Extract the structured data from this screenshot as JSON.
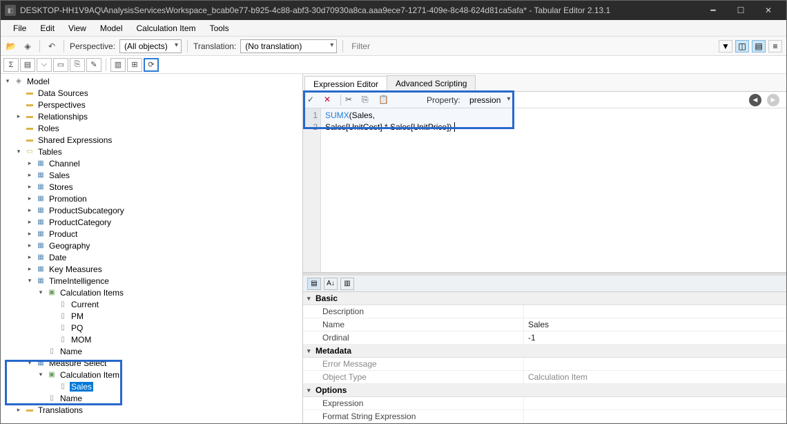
{
  "window": {
    "title": "DESKTOP-HH1V9AQ\\AnalysisServicesWorkspace_bcab0e77-b925-4c88-abf3-30d70930a8ca.aaa9ece7-1271-409e-8c48-624d81ca5afa* - Tabular Editor 2.13.1"
  },
  "menu": {
    "file": "File",
    "edit": "Edit",
    "view": "View",
    "model": "Model",
    "calcItem": "Calculation Item",
    "tools": "Tools"
  },
  "toolbar": {
    "perspective_label": "Perspective:",
    "perspective_value": "(All objects)",
    "translation_label": "Translation:",
    "translation_value": "(No translation)",
    "filter_placeholder": "Filter"
  },
  "tree": {
    "root": "Model",
    "dataSources": "Data Sources",
    "perspectives": "Perspectives",
    "relationships": "Relationships",
    "roles": "Roles",
    "sharedExpr": "Shared Expressions",
    "tables": "Tables",
    "table_items": [
      "Channel",
      "Sales",
      "Stores",
      "Promotion",
      "ProductSubcategory",
      "ProductCategory",
      "Product",
      "Geography",
      "Date",
      "Key Measures",
      "TimeIntelligence"
    ],
    "calcItemsFolder": "Calculation Items",
    "calc_items": [
      "Current",
      "PM",
      "PQ",
      "MOM"
    ],
    "nameCol": "Name",
    "measureSelect": "Measure Select",
    "calcItemFolder2": "Calculation Item",
    "selected": "Sales",
    "name2": "Name",
    "translations": "Translations"
  },
  "tabs": {
    "expr": "Expression Editor",
    "scripting": "Advanced Scripting"
  },
  "editor": {
    "property_suffix": "pression",
    "line1_fn": "SUMX",
    "line1_rest": "(Sales,",
    "line2": "Sales[UnitCost] * Sales[UnitPrice])"
  },
  "props": {
    "cat_basic": "Basic",
    "description": "Description",
    "name": "Name",
    "name_val": "Sales",
    "ordinal": "Ordinal",
    "ordinal_val": "-1",
    "cat_meta": "Metadata",
    "errorMsg": "Error Message",
    "objType": "Object Type",
    "objType_val": "Calculation Item",
    "cat_options": "Options",
    "expression": "Expression",
    "formatStr": "Format String Expression"
  }
}
